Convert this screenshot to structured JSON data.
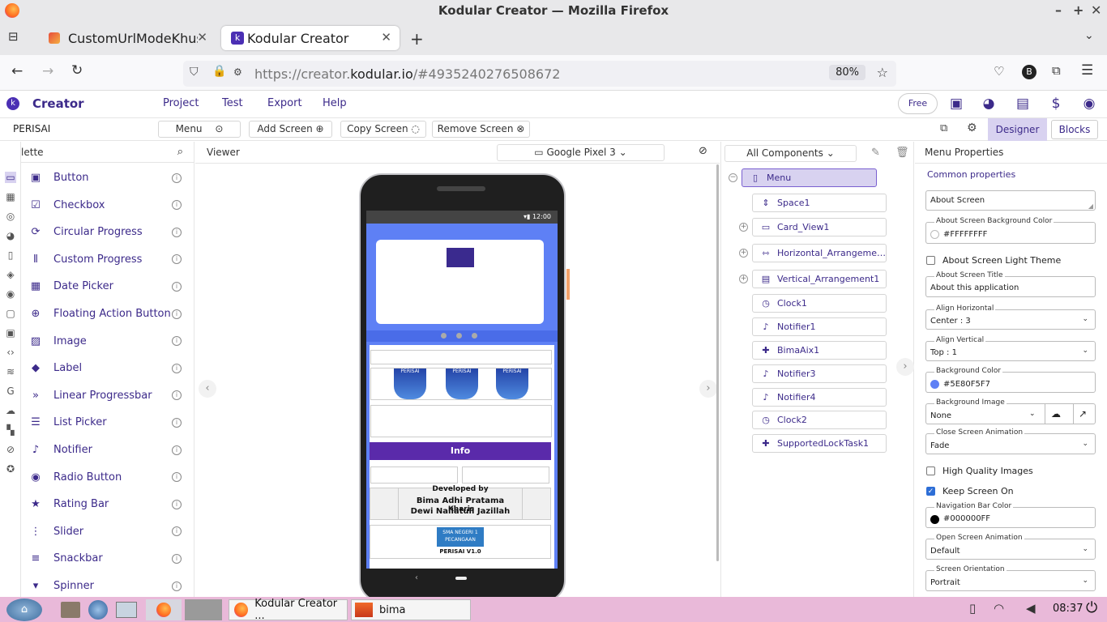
{
  "window": {
    "title": "Kodular Creator — Mozilla Firefox"
  },
  "tabs": [
    {
      "label": "CustomUrlModeKhusus"
    },
    {
      "label": "Kodular Creator"
    }
  ],
  "address": {
    "prefix": "https://creator.",
    "domain": "kodular.io",
    "suffix": "/#4935240276508672",
    "zoom": "80%"
  },
  "app": {
    "brand": "Creator",
    "menu": [
      "Project",
      "Test",
      "Export",
      "Help"
    ],
    "plan": "Free"
  },
  "toolbar": {
    "project": "PERISAI",
    "screen": "Menu",
    "add": "Add Screen",
    "copy": "Copy Screen",
    "remove": "Remove Screen",
    "designer": "Designer",
    "blocks": "Blocks"
  },
  "palette": {
    "title": "Palette",
    "items": [
      {
        "label": "Button",
        "icon": "button-icon"
      },
      {
        "label": "Checkbox",
        "icon": "checkbox-icon"
      },
      {
        "label": "Circular Progress",
        "icon": "circular-progress-icon"
      },
      {
        "label": "Custom Progress",
        "icon": "custom-progress-icon"
      },
      {
        "label": "Date Picker",
        "icon": "calendar-icon"
      },
      {
        "label": "Floating Action Button",
        "icon": "plus-circle-icon"
      },
      {
        "label": "Image",
        "icon": "image-icon"
      },
      {
        "label": "Label",
        "icon": "label-icon"
      },
      {
        "label": "Linear Progressbar",
        "icon": "fast-forward-icon"
      },
      {
        "label": "List Picker",
        "icon": "list-icon"
      },
      {
        "label": "Notifier",
        "icon": "bell-icon"
      },
      {
        "label": "Radio Button",
        "icon": "radio-icon"
      },
      {
        "label": "Rating Bar",
        "icon": "star-icon"
      },
      {
        "label": "Slider",
        "icon": "slider-icon"
      },
      {
        "label": "Snackbar",
        "icon": "snackbar-icon"
      },
      {
        "label": "Spinner",
        "icon": "spinner-icon"
      }
    ]
  },
  "viewer": {
    "title": "Viewer",
    "device": "Google Pixel 3",
    "time": "12:00",
    "info_bar": "Info",
    "dev_line1": "Developed by",
    "dev_line2": "Bima Adhi Pratama",
    "dev_line3": "Dewi Nailatull Jazillah",
    "dev_line4": "Kharis",
    "school1": "SMA NEGERI 1",
    "school2": "PECANGAAN",
    "version": "PERISAI V1.0",
    "logo": "PERISAI"
  },
  "components": {
    "filter": "All Components",
    "nodes": [
      {
        "label": "Menu",
        "icon": "phone-icon"
      },
      {
        "label": "Space1",
        "icon": "space-icon"
      },
      {
        "label": "Card_View1",
        "icon": "card-icon"
      },
      {
        "label": "Horizontal_Arrangeme…",
        "icon": "horizontal-icon"
      },
      {
        "label": "Vertical_Arrangement1",
        "icon": "vertical-icon"
      },
      {
        "label": "Clock1",
        "icon": "clock-icon"
      },
      {
        "label": "Notifier1",
        "icon": "bell-icon"
      },
      {
        "label": "BimaAix1",
        "icon": "puzzle-icon"
      },
      {
        "label": "Notifier3",
        "icon": "bell-icon"
      },
      {
        "label": "Notifier4",
        "icon": "bell-icon"
      },
      {
        "label": "Clock2",
        "icon": "clock-icon"
      },
      {
        "label": "SupportedLockTask1",
        "icon": "puzzle-icon"
      }
    ]
  },
  "properties": {
    "title": "Menu Properties",
    "section": "Common properties",
    "about_screen": "About Screen",
    "about_bg_label": "About Screen Background Color",
    "about_bg_value": "#FFFFFFFF",
    "light_theme": "About Screen Light Theme",
    "about_title_label": "About Screen Title",
    "about_title_value": "About this application",
    "align_h_label": "Align Horizontal",
    "align_h_value": "Center : 3",
    "align_v_label": "Align Vertical",
    "align_v_value": "Top : 1",
    "bg_color_label": "Background Color",
    "bg_color_value": "#5E80F5F7",
    "bg_image_label": "Background Image",
    "bg_image_value": "None",
    "close_anim_label": "Close Screen Animation",
    "close_anim_value": "Fade",
    "hq_images": "High Quality Images",
    "keep_on": "Keep Screen On",
    "nav_color_label": "Navigation Bar Color",
    "nav_color_value": "#000000FF",
    "open_anim_label": "Open Screen Animation",
    "open_anim_value": "Default",
    "orientation_label": "Screen Orientation",
    "orientation_value": "Portrait"
  },
  "taskbar": {
    "app1": "Kodular Creator ...",
    "app2": "bima",
    "clock": "08:37"
  },
  "colors": {
    "accent": "#3c2a8a",
    "screen_bg": "#5e80f5",
    "purple_bar": "#5a2aaa",
    "taskbar": "#e9b9d9"
  }
}
